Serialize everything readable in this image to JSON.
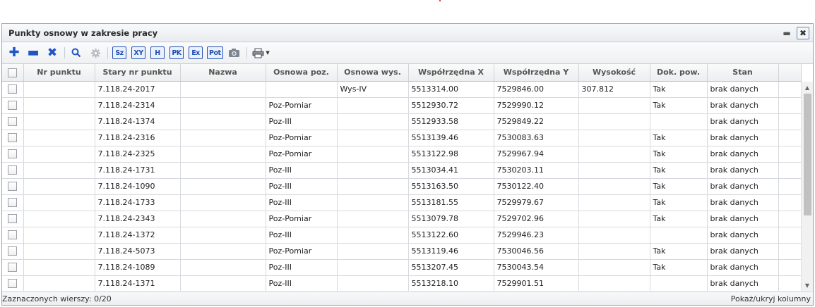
{
  "window": {
    "title": "Punkty osnowy w zakresie pracy"
  },
  "toolbar": {
    "buttons": [
      {
        "icon": "plus-icon",
        "glyph": "+"
      },
      {
        "icon": "minus-icon",
        "glyph": "−"
      },
      {
        "icon": "close-x-icon",
        "glyph": "✖"
      },
      {
        "icon": "search-icon",
        "glyph": ""
      },
      {
        "icon": "gear-icon",
        "glyph": "✸"
      },
      {
        "icon": "sz-icon",
        "label": "Sz"
      },
      {
        "icon": "xy-icon",
        "label": "XY"
      },
      {
        "icon": "h-icon",
        "label": "H"
      },
      {
        "icon": "pk-icon",
        "label": "PK"
      },
      {
        "icon": "ex-icon",
        "label": "Ex"
      },
      {
        "icon": "pot-icon",
        "label": "Pot"
      },
      {
        "icon": "camera-icon",
        "glyph": ""
      },
      {
        "icon": "printer-icon",
        "glyph": ""
      }
    ]
  },
  "table": {
    "columns": [
      "Nr punktu",
      "Stary nr punktu",
      "Nazwa",
      "Osnowa poz.",
      "Osnowa wys.",
      "Współrzędna X",
      "Współrzędna Y",
      "Wysokość",
      "Dok. pow.",
      "Stan"
    ],
    "rows": [
      [
        "",
        "7.118.24-2017",
        "",
        "",
        "Wys-IV",
        "5513314.00",
        "7529846.00",
        "307.812",
        "Tak",
        "brak danych"
      ],
      [
        "",
        "7.118.24-2314",
        "",
        "Poz-Pomiar",
        "",
        "5512930.72",
        "7529990.12",
        "",
        "Tak",
        "brak danych"
      ],
      [
        "",
        "7.118.24-1374",
        "",
        "Poz-III",
        "",
        "5512933.58",
        "7529849.22",
        "",
        "",
        "brak danych"
      ],
      [
        "",
        "7.118.24-2316",
        "",
        "Poz-Pomiar",
        "",
        "5513139.46",
        "7530083.63",
        "",
        "Tak",
        "brak danych"
      ],
      [
        "",
        "7.118.24-2325",
        "",
        "Poz-Pomiar",
        "",
        "5513122.98",
        "7529967.94",
        "",
        "Tak",
        "brak danych"
      ],
      [
        "",
        "7.118.24-1731",
        "",
        "Poz-III",
        "",
        "5513034.41",
        "7530203.11",
        "",
        "Tak",
        "brak danych"
      ],
      [
        "",
        "7.118.24-1090",
        "",
        "Poz-III",
        "",
        "5513163.50",
        "7530122.40",
        "",
        "Tak",
        "brak danych"
      ],
      [
        "",
        "7.118.24-1733",
        "",
        "Poz-III",
        "",
        "5513181.55",
        "7529979.67",
        "",
        "Tak",
        "brak danych"
      ],
      [
        "",
        "7.118.24-2343",
        "",
        "Poz-Pomiar",
        "",
        "5513079.78",
        "7529702.96",
        "",
        "Tak",
        "brak danych"
      ],
      [
        "",
        "7.118.24-1372",
        "",
        "Poz-III",
        "",
        "5513122.60",
        "7529946.23",
        "",
        "",
        "brak danych"
      ],
      [
        "",
        "7.118.24-5073",
        "",
        "Poz-Pomiar",
        "",
        "5513119.46",
        "7530046.56",
        "",
        "Tak",
        "brak danych"
      ],
      [
        "",
        "7.118.24-1089",
        "",
        "Poz-III",
        "",
        "5513207.45",
        "7530043.54",
        "",
        "Tak",
        "brak danych"
      ],
      [
        "",
        "7.118.24-1371",
        "",
        "Poz-III",
        "",
        "5513218.10",
        "7529901.51",
        "",
        "",
        "brak danych"
      ]
    ]
  },
  "status": {
    "selected": "Zaznaczonych wierszy: 0/20",
    "toggle_columns": "Pokaż/ukryj kolumny"
  }
}
